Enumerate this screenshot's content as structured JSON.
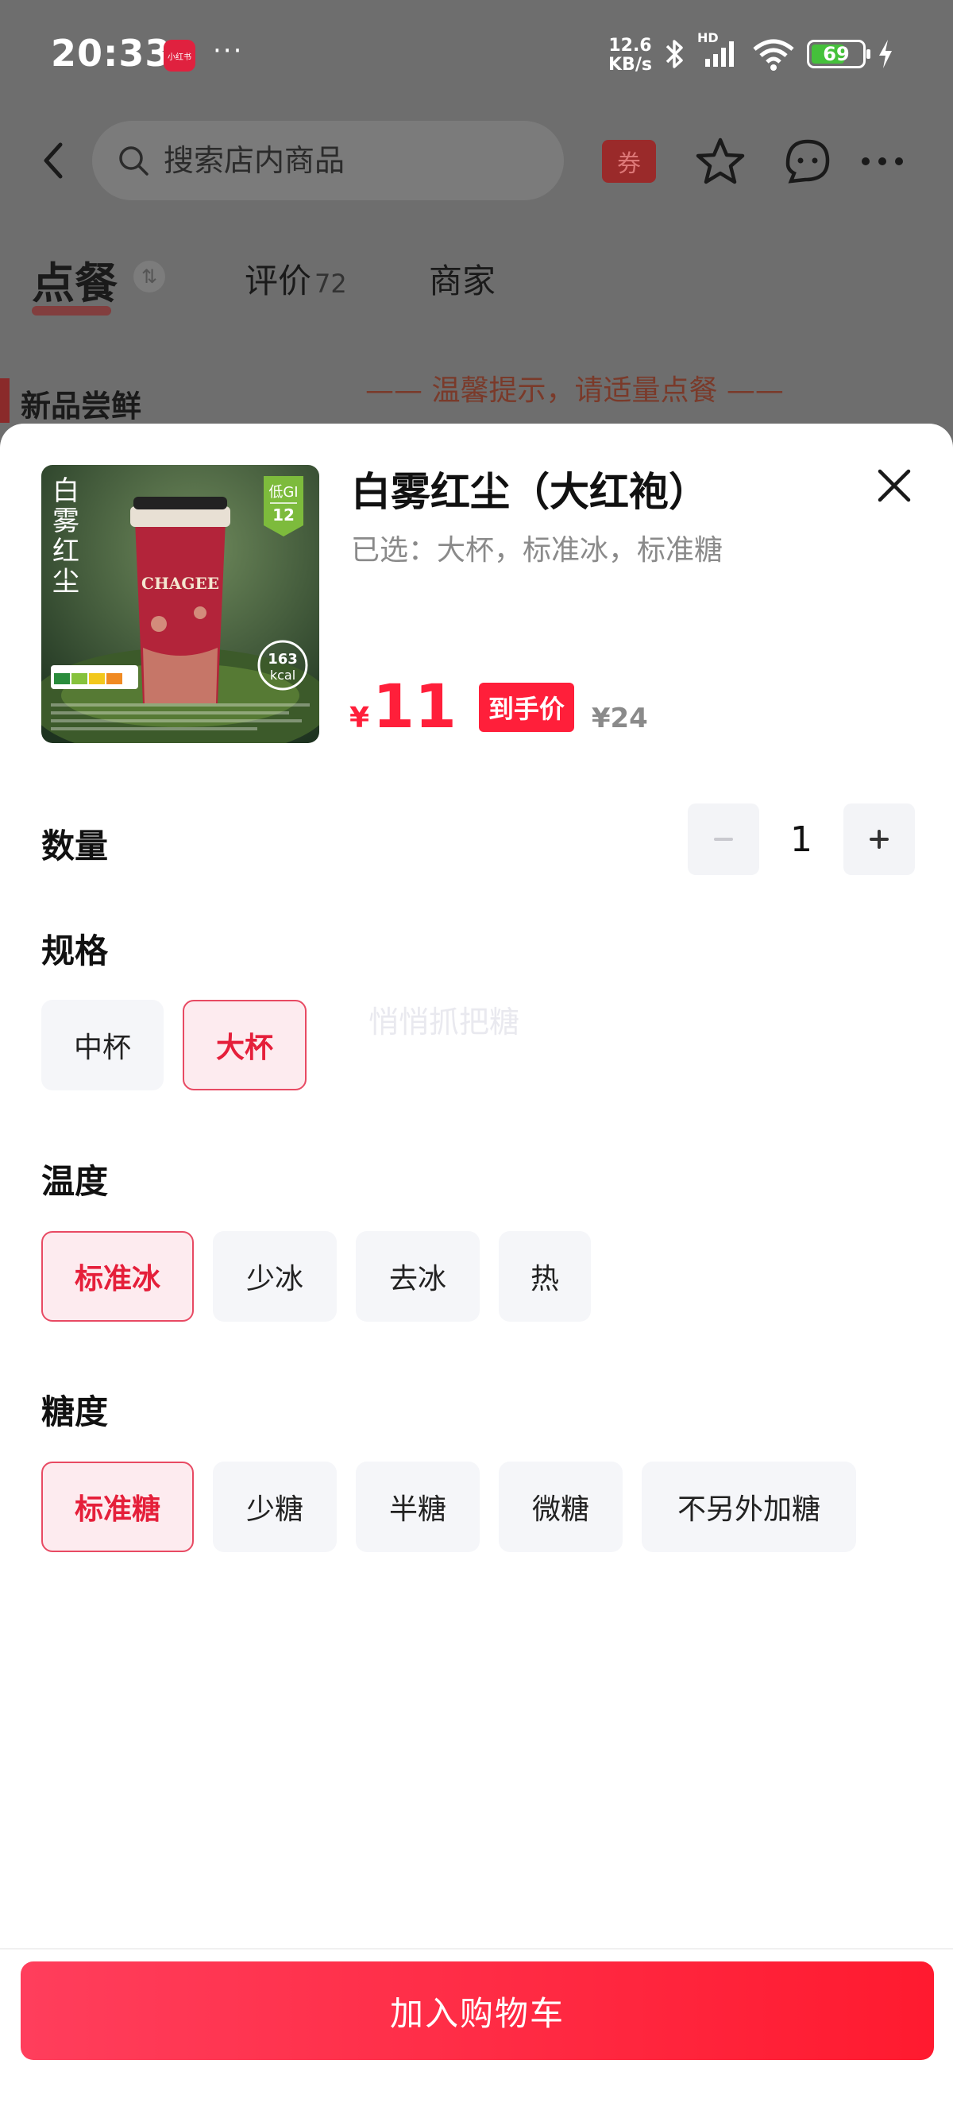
{
  "status_bar": {
    "time": "20:33",
    "app_badge": "小红书",
    "more": "···",
    "net_speed_value": "12.6",
    "net_speed_unit": "KB/s",
    "hd_label": "HD",
    "battery": "69"
  },
  "nav": {
    "search_placeholder": "搜索店内商品",
    "coupon_label": "券"
  },
  "tabs": [
    {
      "label": "点餐"
    },
    {
      "label": "评价",
      "count": "72"
    },
    {
      "label": "商家"
    }
  ],
  "background": {
    "category": "新品尝鲜",
    "tip": "—— 温馨提示，请适量点餐 ——"
  },
  "product": {
    "name": "白雾红尘（大红袍）",
    "selected_text": "已选：大杯，标准冰，标准糖",
    "currency": "¥",
    "price": "11",
    "deal_label": "到手价",
    "original_price": "¥24",
    "image": {
      "title_chars": "白雾红尘",
      "gi_label": "低GI",
      "gi_value": "12",
      "brand": "CHAGEE",
      "kcal_value": "163",
      "kcal_unit": "kcal",
      "bg_color": "#2f4a2c",
      "cup_color": "#b3243a"
    }
  },
  "quantity": {
    "label": "数量",
    "value": "1",
    "minus": "−",
    "plus": "+"
  },
  "spec": {
    "label": "规格",
    "options": [
      {
        "label": "中杯",
        "selected": false
      },
      {
        "label": "大杯",
        "selected": true
      }
    ],
    "watermark": "悄悄抓把糖"
  },
  "temperature": {
    "label": "温度",
    "options": [
      {
        "label": "标准冰",
        "selected": true
      },
      {
        "label": "少冰",
        "selected": false
      },
      {
        "label": "去冰",
        "selected": false
      },
      {
        "label": "热",
        "selected": false
      }
    ]
  },
  "sugar": {
    "label": "糖度",
    "options": [
      {
        "label": "标准糖",
        "selected": true
      },
      {
        "label": "少糖",
        "selected": false
      },
      {
        "label": "半糖",
        "selected": false
      },
      {
        "label": "微糖",
        "selected": false
      },
      {
        "label": "不另外加糖",
        "selected": false
      }
    ]
  },
  "cart_button": "加入购物车",
  "colors": {
    "accent": "#ff1f3a",
    "selected_bg": "#fdebef",
    "option_bg": "#f5f6f9"
  }
}
